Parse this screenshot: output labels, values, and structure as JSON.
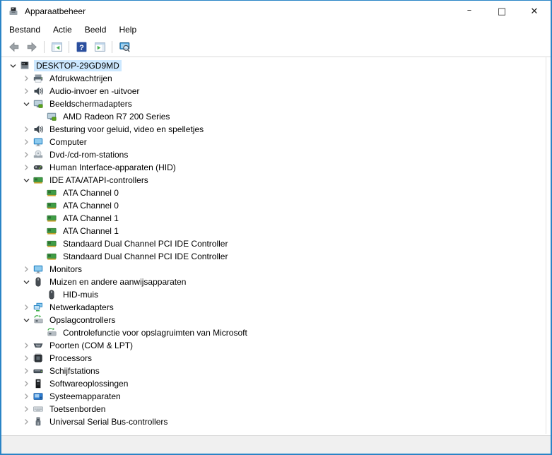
{
  "window": {
    "title": "Apparaatbeheer",
    "controls": {
      "minimize": "–",
      "maximize": "□",
      "close": "✕"
    }
  },
  "colors": {
    "window_border": "#2a84c6",
    "selection_bg": "#cce8ff",
    "statusbar_bg": "#f0f0f0",
    "panel_border": "#d9d9d9"
  },
  "menu": {
    "items": [
      {
        "id": "bestand",
        "label": "Bestand"
      },
      {
        "id": "actie",
        "label": "Actie"
      },
      {
        "id": "beeld",
        "label": "Beeld"
      },
      {
        "id": "help",
        "label": "Help"
      }
    ]
  },
  "toolbar": {
    "buttons": [
      {
        "type": "button",
        "name": "back",
        "icon": "arrow-left"
      },
      {
        "type": "button",
        "name": "forward",
        "icon": "arrow-right"
      },
      {
        "type": "separator"
      },
      {
        "type": "button",
        "name": "console-tree-toggle",
        "icon": "console-tree-toggle"
      },
      {
        "type": "separator"
      },
      {
        "type": "button",
        "name": "help",
        "icon": "help"
      },
      {
        "type": "button",
        "name": "action-pane-toggle",
        "icon": "action-pane-toggle"
      },
      {
        "type": "separator"
      },
      {
        "type": "button",
        "name": "scan-hardware-changes",
        "icon": "scan-hardware"
      }
    ]
  },
  "tree": {
    "rows": [
      {
        "label": "DESKTOP-29GD9MD",
        "level": 0,
        "state": "expanded",
        "icon": "computer-root",
        "selected": true
      },
      {
        "label": "Afdrukwachtrijen",
        "level": 1,
        "state": "collapsed",
        "icon": "printer"
      },
      {
        "label": "Audio-invoer en -uitvoer",
        "level": 1,
        "state": "collapsed",
        "icon": "speaker"
      },
      {
        "label": "Beeldschermadapters",
        "level": 1,
        "state": "expanded",
        "icon": "display-adapter"
      },
      {
        "label": "AMD Radeon R7 200 Series",
        "level": 2,
        "state": "leaf",
        "icon": "display-adapter"
      },
      {
        "label": "Besturing voor geluid, video en spelletjes",
        "level": 1,
        "state": "collapsed",
        "icon": "speaker"
      },
      {
        "label": "Computer",
        "level": 1,
        "state": "collapsed",
        "icon": "monitor"
      },
      {
        "label": "Dvd-/cd-rom-stations",
        "level": 1,
        "state": "collapsed",
        "icon": "optical-drive"
      },
      {
        "label": "Human Interface-apparaten (HID)",
        "level": 1,
        "state": "collapsed",
        "icon": "hid-device"
      },
      {
        "label": "IDE ATA/ATAPI-controllers",
        "level": 1,
        "state": "expanded",
        "icon": "ide-controller"
      },
      {
        "label": "ATA Channel 0",
        "level": 2,
        "state": "leaf",
        "icon": "ide-controller"
      },
      {
        "label": "ATA Channel 0",
        "level": 2,
        "state": "leaf",
        "icon": "ide-controller"
      },
      {
        "label": "ATA Channel 1",
        "level": 2,
        "state": "leaf",
        "icon": "ide-controller"
      },
      {
        "label": "ATA Channel 1",
        "level": 2,
        "state": "leaf",
        "icon": "ide-controller"
      },
      {
        "label": "Standaard Dual Channel PCI IDE Controller",
        "level": 2,
        "state": "leaf",
        "icon": "ide-controller"
      },
      {
        "label": "Standaard Dual Channel PCI IDE Controller",
        "level": 2,
        "state": "leaf",
        "icon": "ide-controller"
      },
      {
        "label": "Monitors",
        "level": 1,
        "state": "collapsed",
        "icon": "monitor"
      },
      {
        "label": "Muizen en andere aanwijsapparaten",
        "level": 1,
        "state": "expanded",
        "icon": "mouse"
      },
      {
        "label": "HID-muis",
        "level": 2,
        "state": "leaf",
        "icon": "mouse"
      },
      {
        "label": "Netwerkadapters",
        "level": 1,
        "state": "collapsed",
        "icon": "network-adapter"
      },
      {
        "label": "Opslagcontrollers",
        "level": 1,
        "state": "expanded",
        "icon": "storage-controller"
      },
      {
        "label": "Controlefunctie voor opslagruimten van Microsoft",
        "level": 2,
        "state": "leaf",
        "icon": "storage-controller"
      },
      {
        "label": "Poorten (COM & LPT)",
        "level": 1,
        "state": "collapsed",
        "icon": "serial-port"
      },
      {
        "label": "Processors",
        "level": 1,
        "state": "collapsed",
        "icon": "processor"
      },
      {
        "label": "Schijfstations",
        "level": 1,
        "state": "collapsed",
        "icon": "disk-drive"
      },
      {
        "label": "Softwareoplossingen",
        "level": 1,
        "state": "collapsed",
        "icon": "software-component"
      },
      {
        "label": "Systeemapparaten",
        "level": 1,
        "state": "collapsed",
        "icon": "system-device"
      },
      {
        "label": "Toetsenborden",
        "level": 1,
        "state": "collapsed",
        "icon": "keyboard"
      },
      {
        "label": "Universal Serial Bus-controllers",
        "level": 1,
        "state": "collapsed",
        "icon": "usb-controller"
      }
    ]
  },
  "statusbar": {
    "text": ""
  }
}
